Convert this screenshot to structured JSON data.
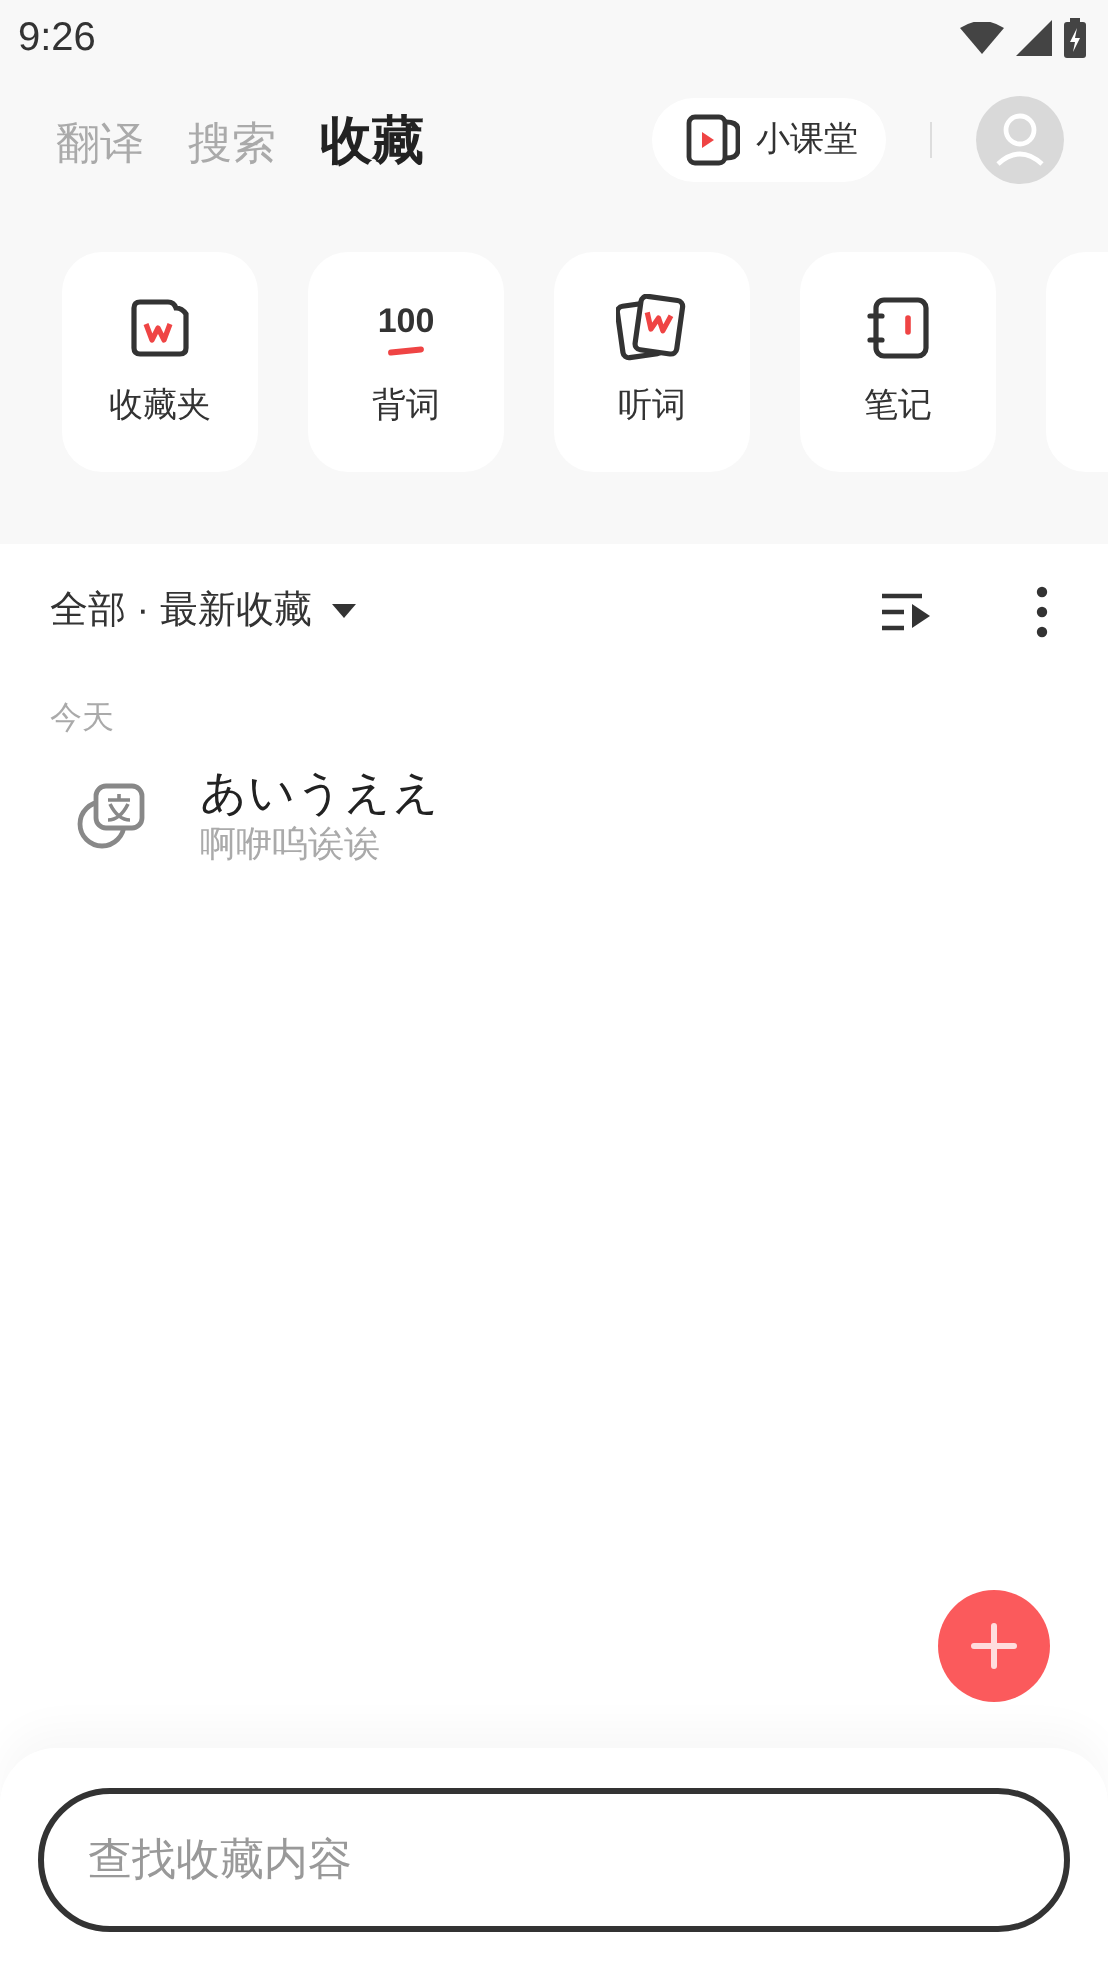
{
  "status_bar": {
    "time": "9:26"
  },
  "tabs": [
    {
      "label": "翻译",
      "selected": false
    },
    {
      "label": "搜索",
      "selected": false
    },
    {
      "label": "收藏",
      "selected": true
    }
  ],
  "class_button": {
    "label": "小课堂"
  },
  "shortcuts": [
    {
      "kind": "folder",
      "label": "收藏夹"
    },
    {
      "kind": "hundred",
      "badge": "100",
      "label": "背词"
    },
    {
      "kind": "cards",
      "label": "听词"
    },
    {
      "kind": "notebook",
      "label": "笔记"
    }
  ],
  "filter": {
    "label": "全部 · 最新收藏"
  },
  "groups": [
    {
      "heading": "今天",
      "items": [
        {
          "word": "あいうええ",
          "translation": "啊咿呜诶诶"
        }
      ]
    }
  ],
  "search": {
    "placeholder": "查找收藏内容"
  }
}
